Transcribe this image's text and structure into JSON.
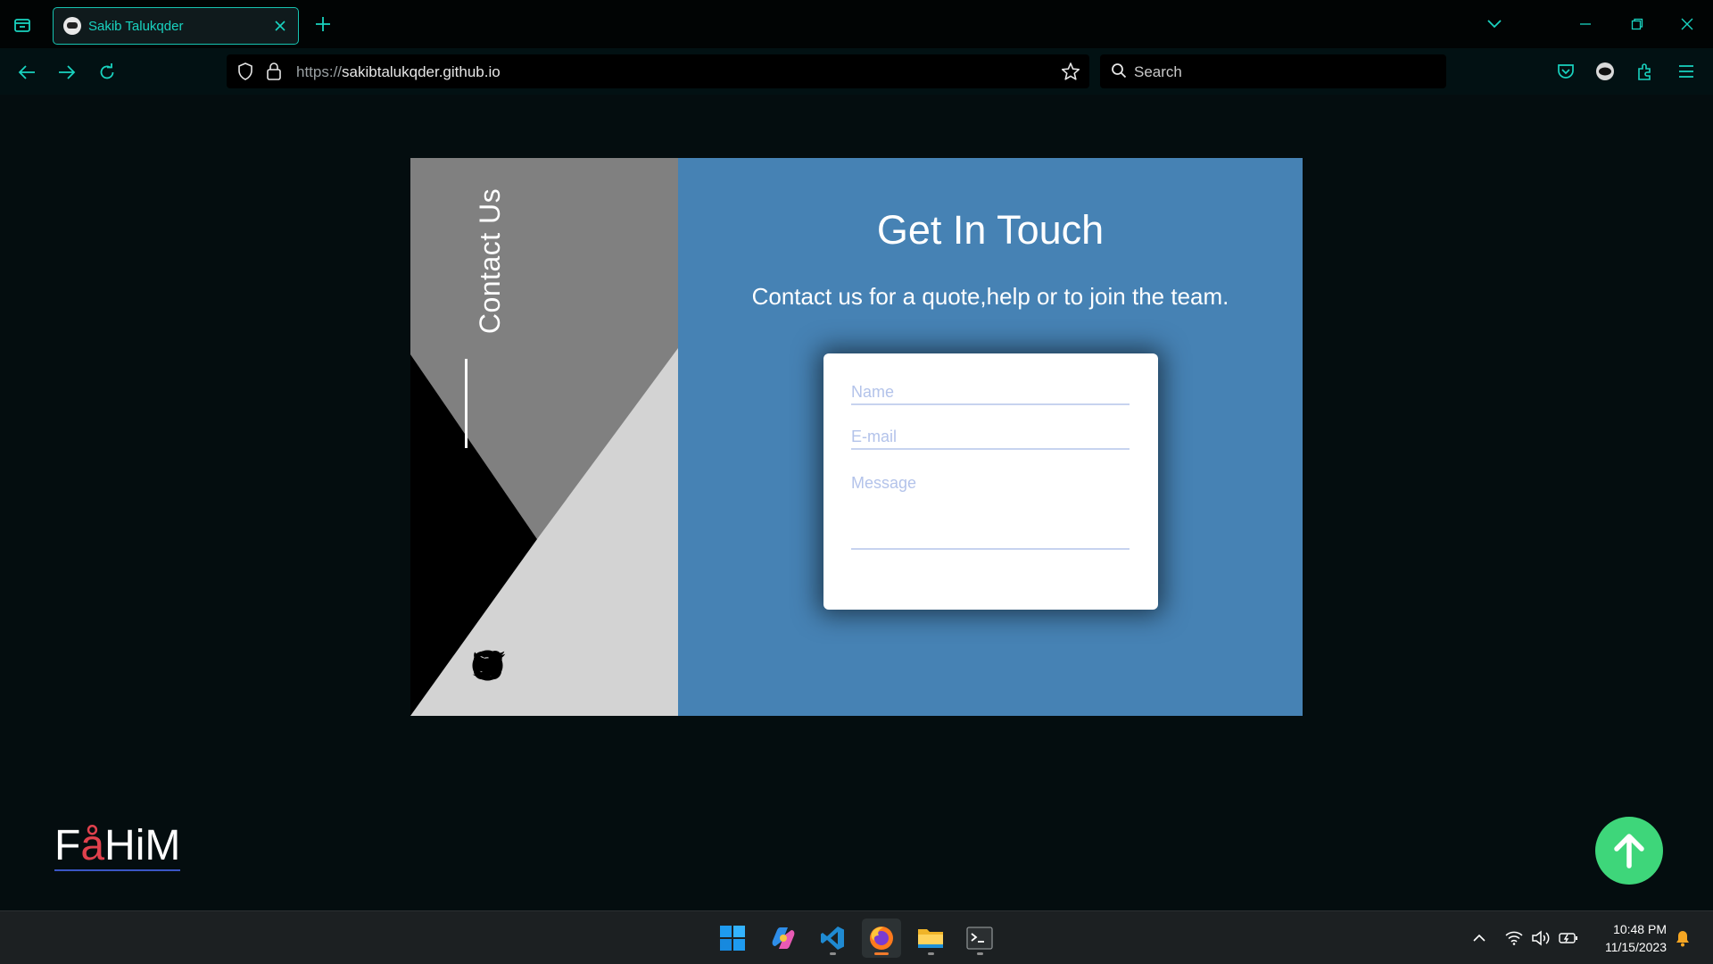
{
  "browser": {
    "tab_title": "Sakib Talukqder",
    "url_protocol": "https://",
    "url_host": "sakibtalukqder.github.io",
    "search_placeholder": "Search"
  },
  "page": {
    "vertical_label": "Contact Us",
    "heading": "Get In Touch",
    "subheading": "Contact us for a quote,help or to join the team.",
    "form": {
      "name_placeholder": "Name",
      "email_placeholder": "E-mail",
      "message_placeholder": "Message"
    },
    "socials": [
      "facebook-icon",
      "github-icon",
      "instagram-icon",
      "twitter-icon"
    ],
    "logo_prefix": "F",
    "logo_accent": "å",
    "logo_suffix": "HiM"
  },
  "colors": {
    "accent_teal": "#16c3b1",
    "panel_blue": "#4682b4",
    "panel_gray": "#808080",
    "panel_lightgray": "#d3d3d3",
    "scroll_top_green": "#3ed67a",
    "logo_accent": "#e0414d"
  },
  "taskbar": {
    "apps": [
      "windows-start-icon",
      "copilot-icon",
      "vscode-icon",
      "firefox-icon",
      "file-explorer-icon",
      "terminal-icon"
    ],
    "time": "10:48 PM",
    "date": "11/15/2023"
  }
}
